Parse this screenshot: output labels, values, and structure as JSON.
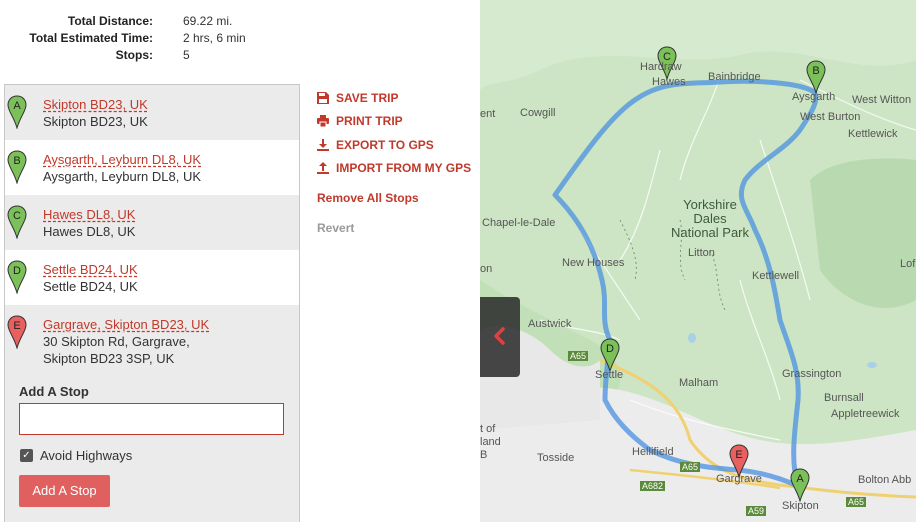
{
  "summary": {
    "distance_label": "Total Distance:",
    "distance_value": "69.22 mi.",
    "time_label": "Total Estimated Time:",
    "time_value": "2 hrs, 6 min",
    "stops_label": "Stops:",
    "stops_value": "5"
  },
  "stops": [
    {
      "letter": "A",
      "title": "Skipton BD23, UK",
      "address": "Skipton BD23, UK",
      "color": "#7cc05a"
    },
    {
      "letter": "B",
      "title": "Aysgarth, Leyburn DL8, UK",
      "address": "Aysgarth, Leyburn DL8, UK",
      "color": "#7cc05a"
    },
    {
      "letter": "C",
      "title": "Hawes DL8, UK",
      "address": "Hawes DL8, UK",
      "color": "#7cc05a"
    },
    {
      "letter": "D",
      "title": "Settle BD24, UK",
      "address": "Settle BD24, UK",
      "color": "#7cc05a"
    },
    {
      "letter": "E",
      "title": "Gargrave, Skipton BD23, UK",
      "address_line1": "30 Skipton Rd, Gargrave,",
      "address_line2": "Skipton BD23 3SP, UK",
      "color": "#e86060"
    }
  ],
  "add_stop": {
    "label": "Add A Stop",
    "input_value": "",
    "avoid_highways_label": "Avoid Highways",
    "avoid_highways_checked": true,
    "button_label": "Add A Stop"
  },
  "actions": {
    "save": "SAVE TRIP",
    "print": "PRINT TRIP",
    "export": "EXPORT TO GPS",
    "import": "IMPORT FROM MY GPS",
    "remove_all": "Remove All Stops",
    "revert": "Revert"
  },
  "map": {
    "labels": {
      "hardraw": "Hardraw",
      "hawes": "Hawes",
      "bainbridge": "Bainbridge",
      "aysgarth": "Aysgarth",
      "west_witton": "West Witton",
      "ent": "ent",
      "cowgill": "Cowgill",
      "west_burton": "West Burton",
      "kettlewick": "Kettlewick",
      "chapel": "Chapel-le-Dale",
      "park1": "Yorkshire",
      "park2": "Dales",
      "park3": "National Park",
      "litton": "Litton",
      "lof": "Lof",
      "on": "on",
      "new_houses": "New Houses",
      "kettlewell": "Kettlewell",
      "austwick": "Austwick",
      "a65_1": "A65",
      "settle": "Settle",
      "grassington": "Grassington",
      "malham": "Malham",
      "burnsall": "Burnsall",
      "appletreewick": "Appletreewick",
      "rt_of": "t of",
      "land": "land",
      "b": "B",
      "tosside": "Tosside",
      "hellifield": "Hellifield",
      "a65_2": "A65",
      "gargrave": "Gargrave",
      "a682": "A682",
      "bolton_abb": "Bolton Abb",
      "a59": "A59",
      "skipton": "Skipton",
      "a65_3": "A65"
    },
    "route_color": "#5b9bd5"
  }
}
